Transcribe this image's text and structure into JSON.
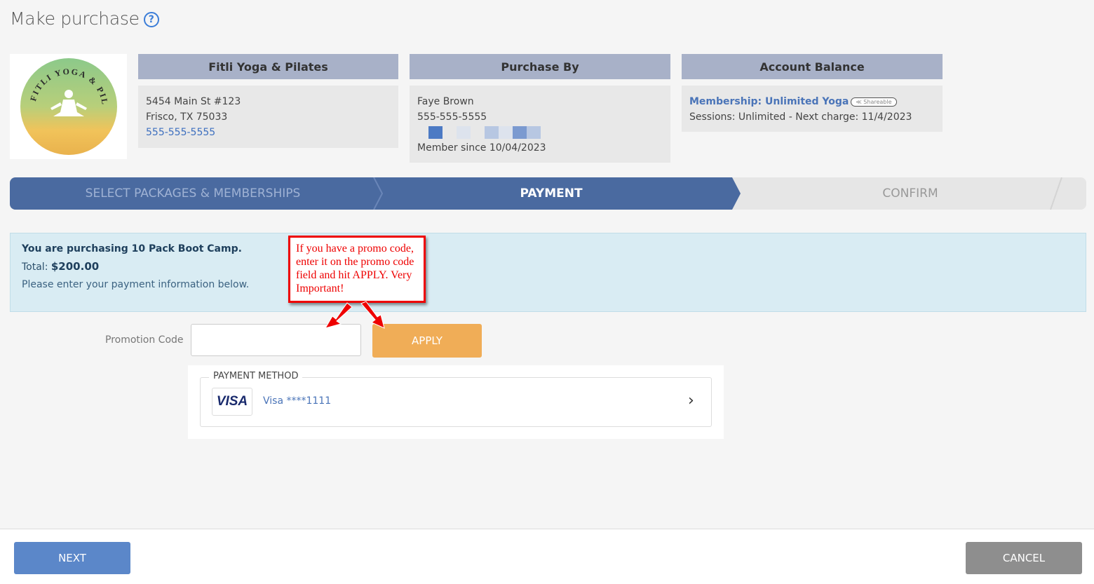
{
  "page": {
    "title": "Make purchase"
  },
  "logo": {
    "alt_text": "FITLI YOGA & PILATES"
  },
  "studio": {
    "header": "Fitli Yoga & Pilates",
    "address1": "5454 Main St #123",
    "address2": "Frisco, TX 75033",
    "phone": "555-555-5555"
  },
  "purchaser": {
    "header": "Purchase By",
    "name": "Faye Brown",
    "phone": "555-555-5555",
    "member_since": "Member since 10/04/2023"
  },
  "account": {
    "header": "Account Balance",
    "membership": "Membership: Unlimited Yoga",
    "shareable_badge": "Shareable",
    "details": "Sessions: Unlimited -  Next charge: 11/4/2023"
  },
  "wizard": {
    "steps": [
      {
        "label": "SELECT PACKAGES & MEMBERSHIPS",
        "state": "done"
      },
      {
        "label": "PAYMENT",
        "state": "active"
      },
      {
        "label": "CONFIRM",
        "state": "upcoming"
      }
    ]
  },
  "summary": {
    "purchasing": "You are purchasing 10 Pack Boot Camp.",
    "total_label": "Total: ",
    "total_value": "$200.00",
    "instruction": "Please enter your payment information below."
  },
  "callout": {
    "text": "If you have a promo code, enter it on the promo code field and hit APPLY. Very Important!"
  },
  "promo": {
    "label": "Promotion Code",
    "value": "",
    "apply_label": "APPLY"
  },
  "payment_method": {
    "legend": "PAYMENT METHOD",
    "card_brand": "VISA",
    "card_text": "Visa ****1111",
    "chevron": "›"
  },
  "footer": {
    "next_label": "NEXT",
    "cancel_label": "CANCEL"
  },
  "colors": {
    "wizard_active": "#4a6aa0",
    "wizard_inactive": "#e6e6e6",
    "apply": "#f0ad57",
    "next": "#5b87c9",
    "cancel": "#8e8e8e",
    "callout_border": "#ee0000"
  },
  "icons": [
    "help-icon",
    "chevron-right-icon",
    "visa-logo-icon",
    "annotation-arrow-icon"
  ]
}
